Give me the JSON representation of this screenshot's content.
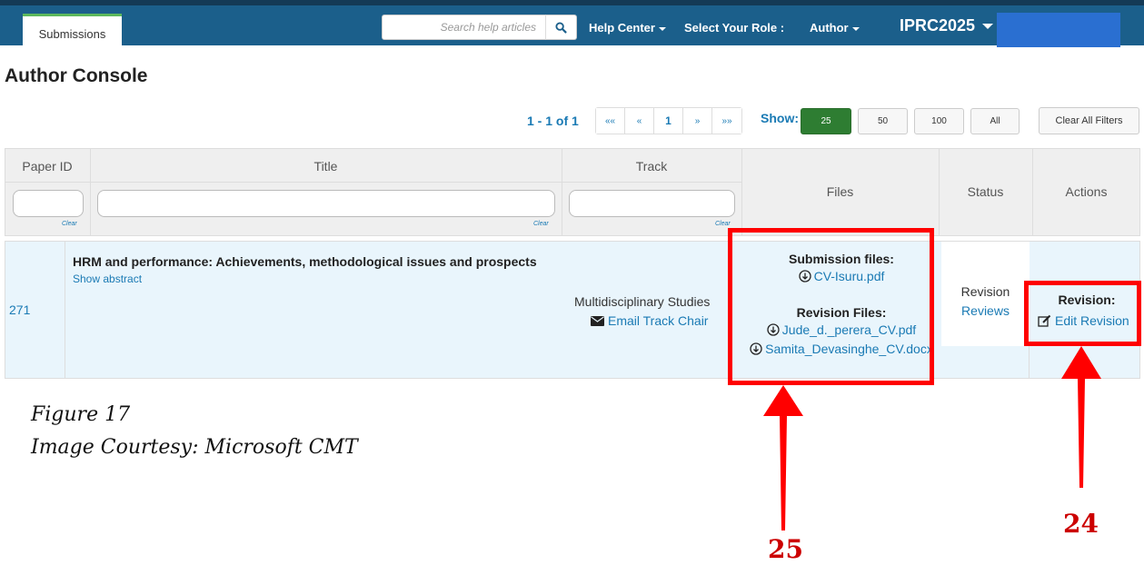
{
  "nav": {
    "tab_submissions": "Submissions",
    "search_placeholder": "Search help articles",
    "help_center": "Help Center",
    "select_role_label": "Select Your Role :",
    "role": "Author",
    "conference": "IPRC2025"
  },
  "page": {
    "title": "Author Console"
  },
  "paging": {
    "range": "1 - 1 of 1",
    "buttons": [
      "««",
      "«",
      "1",
      "»",
      "»»"
    ],
    "show_label": "Show:",
    "show_options": [
      "25",
      "50",
      "100",
      "All"
    ],
    "active_show": "25",
    "clear_all_filters": "Clear All Filters"
  },
  "table": {
    "headers": {
      "paper_id": "Paper ID",
      "title": "Title",
      "track": "Track",
      "files": "Files",
      "status": "Status",
      "actions": "Actions"
    },
    "clear_label": "Clear",
    "row": {
      "paper_id": "271",
      "title": "HRM and performance: Achievements, methodological issues and prospects",
      "show_abstract": "Show abstract",
      "track": "Multidisciplinary Studies",
      "email_track_chair": "Email Track Chair",
      "submission_files_label": "Submission files:",
      "submission_files": [
        "CV-Isuru.pdf"
      ],
      "revision_files_label": "Revision Files:",
      "revision_files": [
        "Jude_d._perera_CV.pdf",
        "Samita_Devasinghe_CV.docx"
      ],
      "status": "Revision",
      "reviews_link": "Reviews",
      "actions_label": "Revision:",
      "edit_revision": "Edit Revision"
    }
  },
  "caption": {
    "figure": "Figure 17",
    "courtesy": "Image Courtesy: Microsoft CMT"
  },
  "callouts": {
    "files": "25",
    "actions": "24"
  },
  "colors": {
    "nav_bg": "#1b5f8b",
    "link": "#1a7ab4",
    "active_green": "#2e7d32",
    "highlight": "#ff0000"
  }
}
